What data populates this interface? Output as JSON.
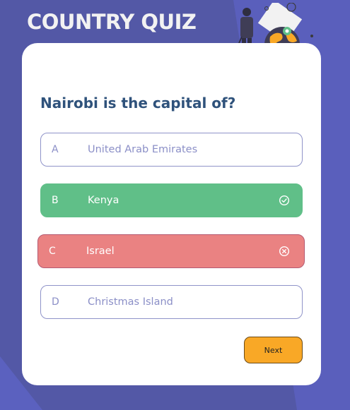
{
  "app": {
    "title": "COUNTRY QUIZ"
  },
  "quiz": {
    "question": "Nairobi is the capital of?",
    "options": [
      {
        "letter": "A",
        "label": "United Arab Emirates",
        "state": "default"
      },
      {
        "letter": "B",
        "label": "Kenya",
        "state": "correct",
        "icon": "check-circle-icon"
      },
      {
        "letter": "C",
        "label": "Israel",
        "state": "wrong",
        "icon": "close-circle-icon"
      },
      {
        "letter": "D",
        "label": "Christmas Island",
        "state": "default"
      }
    ],
    "next_label": "Next"
  },
  "colors": {
    "background": "#5358a6",
    "card": "#ffffff",
    "correct": "#60bf88",
    "wrong": "#ea8282",
    "accent": "#f9a826",
    "question": "#2f527b"
  }
}
